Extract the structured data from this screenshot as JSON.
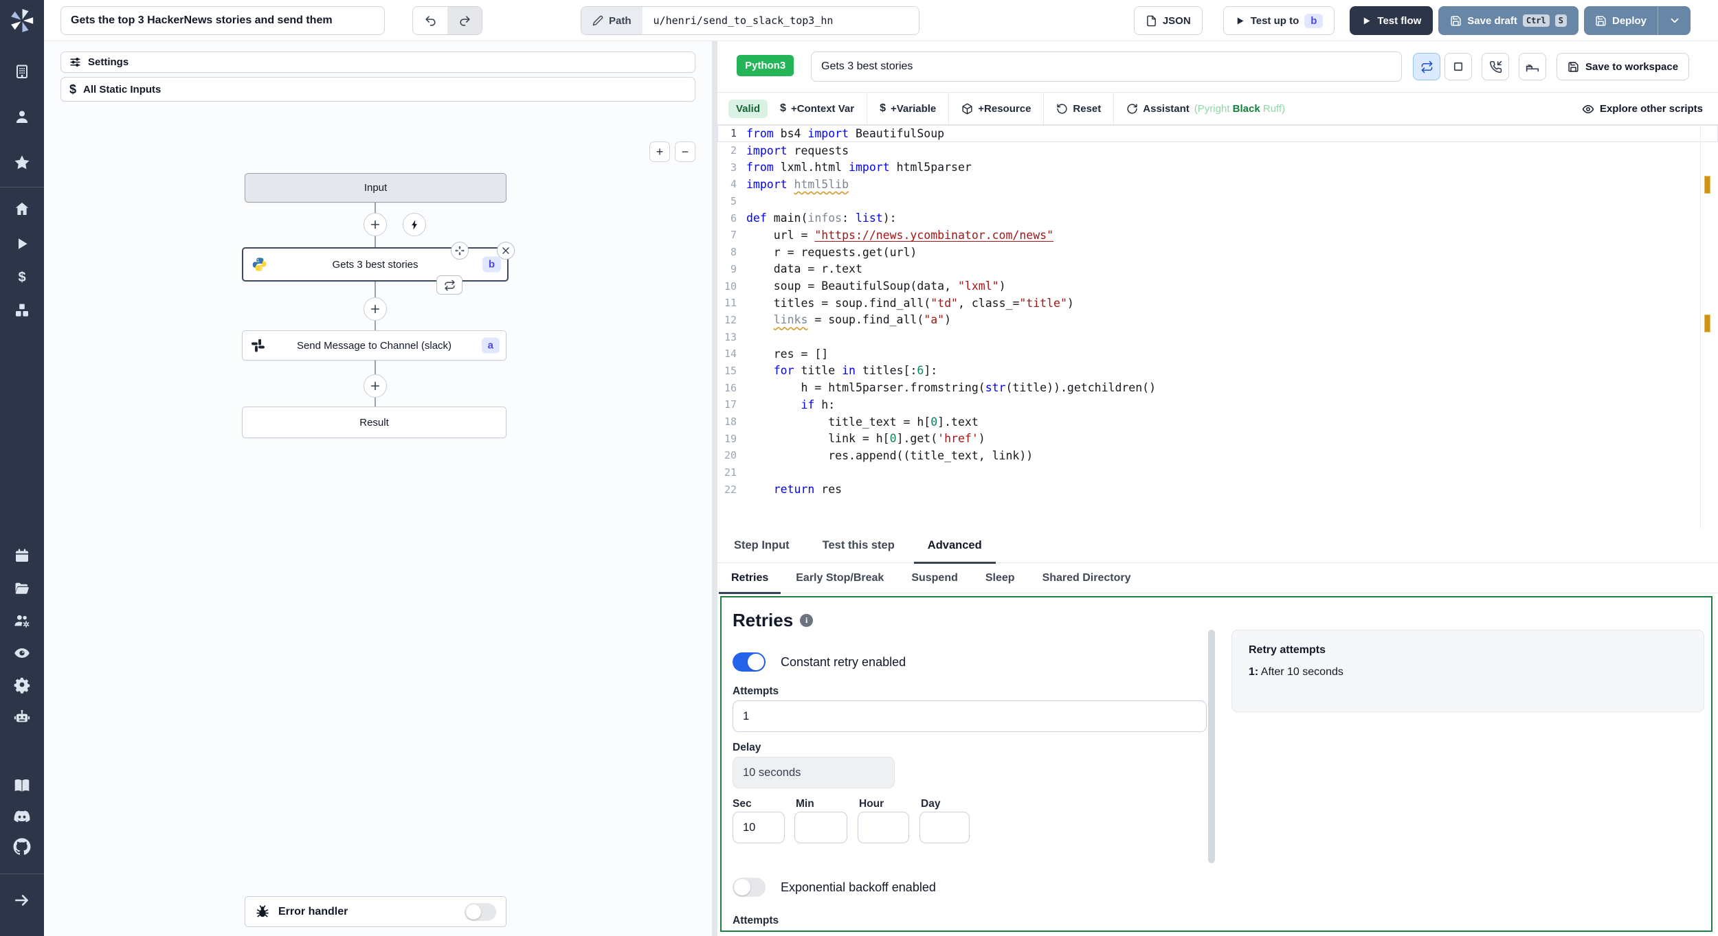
{
  "topbar": {
    "flow_title": "Gets the top 3 HackerNews stories and send them",
    "path_label": "Path",
    "path_value": "u/henri/send_to_slack_top3_hn",
    "json_button": "JSON",
    "test_up_to": "Test up to",
    "test_up_to_step": "b",
    "test_flow": "Test flow",
    "save_draft": "Save draft",
    "save_draft_kbd": [
      "Ctrl",
      "S"
    ],
    "deploy": "Deploy"
  },
  "sidebar": {
    "icons": [
      "windmill-logo",
      "building-icon",
      "user-icon",
      "star-icon",
      "home-icon",
      "play-icon",
      "dollar-icon",
      "boxes-icon",
      "calendar-icon",
      "folder-icon",
      "users-gear-icon",
      "eye-icon",
      "gear-icon",
      "robot-icon",
      "book-icon",
      "discord-icon",
      "github-icon",
      "arrow-right-icon"
    ]
  },
  "flow_panel": {
    "settings": "Settings",
    "all_static_inputs": "All Static Inputs",
    "zoom_in": "+",
    "zoom_out": "−",
    "nodes": {
      "input": "Input",
      "step_b": {
        "label": "Gets 3 best stories",
        "badge": "b"
      },
      "step_a": {
        "label": "Send Message to Channel (slack)",
        "badge": "a"
      },
      "result": "Result",
      "error_handler": "Error handler"
    }
  },
  "step_panel": {
    "language_badge": "Python3",
    "step_name": "Gets 3 best stories",
    "save_to_workspace": "Save to workspace",
    "toolbar": {
      "valid": "Valid",
      "context_var": "+Context Var",
      "variable": "+Variable",
      "resource": "+Resource",
      "reset": "Reset",
      "assistant": "Assistant",
      "assistant_open": "(",
      "assistant_pyright": "Pyright",
      "assistant_black": "Black",
      "assistant_ruff": "Ruff",
      "assistant_close": ")",
      "explore": "Explore other scripts"
    },
    "tabs": [
      "Step Input",
      "Test this step",
      "Advanced"
    ],
    "active_tab": "Advanced",
    "subtabs": [
      "Retries",
      "Early Stop/Break",
      "Suspend",
      "Sleep",
      "Shared Directory"
    ],
    "active_subtab": "Retries",
    "retries": {
      "heading": "Retries",
      "constant_toggle_label": "Constant retry enabled",
      "constant_toggle_on": true,
      "attempts_label": "Attempts",
      "attempts_value": "1",
      "delay_label": "Delay",
      "delay_value": "10 seconds",
      "unit_labels": [
        "Sec",
        "Min",
        "Hour",
        "Day"
      ],
      "sec_value": "10",
      "min_value": "",
      "hour_value": "",
      "day_value": "",
      "exponential_toggle_label": "Exponential backoff enabled",
      "exponential_toggle_on": false,
      "bottom_attempts_label": "Attempts",
      "summary_title": "Retry attempts",
      "summary_line_prefix": "1:",
      "summary_line_text": "After 10 seconds"
    }
  },
  "code": {
    "lines": [
      {
        "n": 1,
        "a": true,
        "t": [
          [
            "k",
            "from"
          ],
          [
            "d",
            " bs4 "
          ],
          [
            "k",
            "import"
          ],
          [
            "d",
            " BeautifulSoup"
          ]
        ]
      },
      {
        "n": 2,
        "t": [
          [
            "k",
            "import"
          ],
          [
            "d",
            " requests"
          ]
        ]
      },
      {
        "n": 3,
        "t": [
          [
            "k",
            "from"
          ],
          [
            "d",
            " lxml.html "
          ],
          [
            "k",
            "import"
          ],
          [
            "d",
            " html5parser"
          ]
        ]
      },
      {
        "n": 4,
        "t": [
          [
            "k",
            "import"
          ],
          [
            "d",
            " "
          ],
          [
            "q",
            "html5lib"
          ]
        ]
      },
      {
        "n": 5,
        "t": []
      },
      {
        "n": 6,
        "t": [
          [
            "k",
            "def"
          ],
          [
            "d",
            " main("
          ],
          [
            "g",
            "infos"
          ],
          [
            "d",
            ": "
          ],
          [
            "k",
            "list"
          ],
          [
            "d",
            "):"
          ]
        ]
      },
      {
        "n": 7,
        "t": [
          [
            "d",
            "    url = "
          ],
          [
            "su",
            "\"https://news.ycombinator.com/news\""
          ]
        ]
      },
      {
        "n": 8,
        "t": [
          [
            "d",
            "    r = requests.get(url)"
          ]
        ]
      },
      {
        "n": 9,
        "t": [
          [
            "d",
            "    data = r.text"
          ]
        ]
      },
      {
        "n": 10,
        "t": [
          [
            "d",
            "    soup = BeautifulSoup(data, "
          ],
          [
            "s",
            "\"lxml\""
          ],
          [
            "d",
            ")"
          ]
        ]
      },
      {
        "n": 11,
        "t": [
          [
            "d",
            "    titles = soup.find_all("
          ],
          [
            "s",
            "\"td\""
          ],
          [
            "d",
            ", class_="
          ],
          [
            "s",
            "\"title\""
          ],
          [
            "d",
            ")"
          ]
        ]
      },
      {
        "n": 12,
        "t": [
          [
            "d",
            "    "
          ],
          [
            "q",
            "links"
          ],
          [
            "d",
            " = soup.find_all("
          ],
          [
            "s",
            "\"a\""
          ],
          [
            "d",
            ")"
          ]
        ]
      },
      {
        "n": 13,
        "t": []
      },
      {
        "n": 14,
        "t": [
          [
            "d",
            "    res = []"
          ]
        ]
      },
      {
        "n": 15,
        "t": [
          [
            "d",
            "    "
          ],
          [
            "k",
            "for"
          ],
          [
            "d",
            " title "
          ],
          [
            "k",
            "in"
          ],
          [
            "d",
            " titles[:"
          ],
          [
            "n2",
            "6"
          ],
          [
            "d",
            "]:"
          ]
        ]
      },
      {
        "n": 16,
        "t": [
          [
            "d",
            "        h = html5parser.fromstring("
          ],
          [
            "k",
            "str"
          ],
          [
            "d",
            "(title)).getchildren()"
          ]
        ]
      },
      {
        "n": 17,
        "t": [
          [
            "d",
            "        "
          ],
          [
            "k",
            "if"
          ],
          [
            "d",
            " h:"
          ]
        ]
      },
      {
        "n": 18,
        "t": [
          [
            "d",
            "            title_text = h["
          ],
          [
            "n2",
            "0"
          ],
          [
            "d",
            "].text"
          ]
        ]
      },
      {
        "n": 19,
        "t": [
          [
            "d",
            "            link = h["
          ],
          [
            "n2",
            "0"
          ],
          [
            "d",
            "].get("
          ],
          [
            "s",
            "'href'"
          ],
          [
            "d",
            ")"
          ]
        ]
      },
      {
        "n": 20,
        "t": [
          [
            "d",
            "            res.append((title_text, link))"
          ]
        ]
      },
      {
        "n": 21,
        "t": []
      },
      {
        "n": 22,
        "t": [
          [
            "d",
            "    "
          ],
          [
            "k",
            "return"
          ],
          [
            "d",
            " res"
          ]
        ]
      }
    ]
  }
}
